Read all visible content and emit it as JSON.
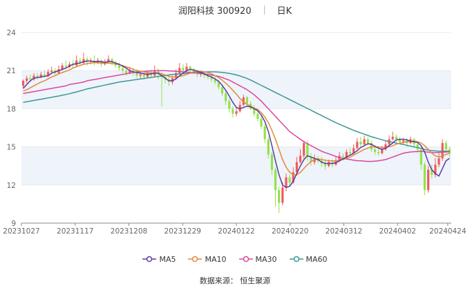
{
  "header": {
    "title": "润阳科技 300920",
    "period": "日K"
  },
  "source_text": "数据来源： 恒生聚源",
  "colors": {
    "up": "#f15a5a",
    "down": "#8fe34b",
    "MA5": "#5b3a9e",
    "MA10": "#e2883c",
    "MA30": "#d9479b",
    "MA60": "#3a9696",
    "band": "#eff3fa",
    "axis": "#666666"
  },
  "chart_data": {
    "type": "candlestick",
    "title": "润阳科技 300920",
    "ylim": [
      9,
      24
    ],
    "yticks": [
      9,
      12,
      15,
      18,
      21,
      24
    ],
    "xticks": [
      "20231027",
      "20231117",
      "20231208",
      "20231229",
      "20240122",
      "20240220",
      "20240312",
      "20240402",
      "20240424"
    ],
    "xtick_index": [
      0,
      15,
      30,
      45,
      60,
      75,
      90,
      105,
      119
    ],
    "legend": [
      "MA5",
      "MA10",
      "MA30",
      "MA60"
    ],
    "legend_position": "bottom",
    "candles": [
      [
        19.8,
        20.2,
        20.3,
        19.6
      ],
      [
        20.2,
        20.4,
        20.6,
        20.0
      ],
      [
        20.4,
        20.3,
        20.7,
        20.1
      ],
      [
        20.3,
        20.6,
        20.8,
        20.2
      ],
      [
        20.6,
        20.5,
        20.8,
        20.3
      ],
      [
        20.5,
        20.7,
        20.9,
        20.4
      ],
      [
        20.7,
        20.6,
        21.0,
        20.5
      ],
      [
        20.6,
        20.9,
        21.1,
        20.5
      ],
      [
        20.9,
        21.0,
        21.3,
        20.8
      ],
      [
        21.0,
        20.8,
        21.2,
        20.6
      ],
      [
        20.8,
        21.1,
        21.4,
        20.7
      ],
      [
        21.1,
        21.4,
        21.6,
        21.0
      ],
      [
        21.4,
        21.3,
        21.8,
        21.1
      ],
      [
        21.3,
        21.5,
        21.7,
        21.2
      ],
      [
        21.5,
        21.4,
        21.8,
        21.2
      ],
      [
        21.4,
        21.8,
        22.2,
        21.3
      ],
      [
        21.8,
        21.6,
        22.0,
        21.4
      ],
      [
        21.6,
        21.9,
        22.4,
        21.5
      ],
      [
        21.9,
        21.7,
        22.1,
        21.4
      ],
      [
        21.7,
        21.8,
        22.0,
        21.5
      ],
      [
        21.8,
        21.6,
        22.2,
        21.4
      ],
      [
        21.6,
        21.8,
        22.0,
        21.5
      ],
      [
        21.8,
        21.5,
        21.9,
        21.3
      ],
      [
        21.5,
        21.7,
        21.9,
        21.4
      ],
      [
        21.7,
        21.9,
        22.2,
        21.6
      ],
      [
        21.9,
        21.6,
        22.0,
        21.4
      ],
      [
        21.6,
        21.4,
        21.8,
        21.2
      ],
      [
        21.4,
        21.2,
        21.6,
        21.0
      ],
      [
        21.2,
        21.0,
        21.4,
        20.8
      ],
      [
        21.0,
        20.8,
        21.2,
        20.6
      ],
      [
        20.8,
        21.0,
        21.3,
        20.7
      ],
      [
        21.0,
        20.9,
        21.2,
        20.6
      ],
      [
        20.9,
        20.6,
        21.1,
        20.4
      ],
      [
        20.6,
        20.7,
        21.0,
        20.4
      ],
      [
        20.7,
        20.5,
        20.9,
        20.3
      ],
      [
        20.5,
        20.8,
        21.0,
        20.4
      ],
      [
        20.8,
        20.6,
        21.1,
        20.4
      ],
      [
        20.6,
        21.0,
        21.4,
        20.5
      ],
      [
        21.0,
        20.7,
        21.2,
        20.3
      ],
      [
        20.7,
        20.5,
        20.9,
        18.2
      ],
      [
        20.5,
        20.3,
        20.7,
        20.0
      ],
      [
        20.3,
        20.1,
        20.5,
        19.8
      ],
      [
        20.1,
        20.4,
        20.6,
        19.9
      ],
      [
        20.4,
        20.8,
        21.1,
        20.3
      ],
      [
        20.8,
        21.2,
        21.6,
        20.7
      ],
      [
        21.2,
        21.0,
        21.5,
        20.8
      ],
      [
        21.0,
        21.3,
        21.6,
        20.9
      ],
      [
        21.3,
        21.1,
        21.4,
        20.8
      ],
      [
        21.1,
        20.9,
        21.2,
        20.7
      ],
      [
        20.9,
        20.7,
        21.1,
        20.5
      ],
      [
        20.7,
        20.8,
        21.0,
        20.5
      ],
      [
        20.8,
        20.6,
        20.9,
        20.4
      ],
      [
        20.6,
        20.5,
        20.8,
        20.3
      ],
      [
        20.5,
        20.3,
        20.7,
        20.1
      ],
      [
        20.3,
        20.1,
        20.5,
        19.9
      ],
      [
        20.1,
        19.7,
        20.3,
        19.5
      ],
      [
        19.7,
        19.2,
        19.9,
        19.0
      ],
      [
        19.2,
        18.6,
        19.4,
        18.3
      ],
      [
        18.6,
        18.0,
        18.8,
        17.7
      ],
      [
        18.0,
        17.6,
        18.2,
        17.3
      ],
      [
        17.6,
        17.8,
        18.1,
        17.4
      ],
      [
        17.8,
        18.3,
        18.6,
        17.7
      ],
      [
        18.3,
        18.9,
        19.1,
        18.2
      ],
      [
        18.9,
        18.4,
        19.0,
        18.2
      ],
      [
        18.4,
        18.0,
        18.6,
        17.9
      ],
      [
        18.0,
        17.6,
        18.3,
        17.4
      ],
      [
        17.6,
        17.2,
        17.8,
        17.0
      ],
      [
        17.2,
        16.6,
        17.4,
        16.4
      ],
      [
        16.6,
        15.6,
        16.8,
        15.3
      ],
      [
        15.6,
        14.4,
        15.8,
        14.1
      ],
      [
        14.4,
        13.2,
        14.6,
        12.8
      ],
      [
        13.2,
        11.6,
        13.4,
        10.3
      ],
      [
        11.6,
        10.6,
        11.9,
        9.8
      ],
      [
        10.6,
        11.8,
        12.2,
        10.4
      ],
      [
        11.8,
        12.6,
        12.9,
        11.5
      ],
      [
        12.6,
        12.2,
        12.8,
        11.9
      ],
      [
        12.2,
        13.0,
        13.4,
        12.1
      ],
      [
        13.0,
        13.8,
        14.2,
        12.9
      ],
      [
        13.8,
        14.3,
        14.8,
        13.7
      ],
      [
        14.3,
        15.3,
        15.5,
        14.1
      ],
      [
        15.3,
        14.2,
        15.5,
        13.9
      ],
      [
        14.2,
        13.8,
        14.5,
        13.5
      ],
      [
        13.8,
        14.1,
        14.4,
        13.6
      ],
      [
        14.1,
        13.9,
        14.3,
        13.7
      ],
      [
        13.9,
        13.7,
        14.2,
        13.4
      ],
      [
        13.7,
        13.5,
        14.0,
        13.2
      ],
      [
        13.5,
        13.8,
        14.0,
        13.4
      ],
      [
        13.8,
        13.6,
        14.0,
        13.4
      ],
      [
        13.6,
        13.9,
        14.2,
        13.5
      ],
      [
        13.9,
        14.3,
        14.6,
        13.8
      ],
      [
        14.3,
        14.2,
        14.5,
        14.0
      ],
      [
        14.2,
        14.6,
        14.8,
        14.1
      ],
      [
        14.6,
        14.5,
        14.9,
        14.3
      ],
      [
        14.5,
        14.9,
        15.2,
        14.4
      ],
      [
        14.9,
        15.4,
        15.7,
        14.8
      ],
      [
        15.4,
        15.2,
        15.8,
        15.0
      ],
      [
        15.2,
        15.6,
        15.9,
        15.1
      ],
      [
        15.6,
        15.3,
        15.8,
        15.1
      ],
      [
        15.3,
        14.8,
        15.5,
        14.6
      ],
      [
        14.8,
        14.6,
        15.0,
        14.4
      ],
      [
        14.6,
        14.5,
        14.9,
        14.3
      ],
      [
        14.5,
        14.8,
        15.1,
        14.4
      ],
      [
        14.8,
        15.2,
        15.5,
        14.7
      ],
      [
        15.2,
        15.6,
        15.9,
        15.1
      ],
      [
        15.6,
        15.8,
        16.2,
        15.5
      ],
      [
        15.8,
        15.6,
        16.0,
        15.4
      ],
      [
        15.6,
        15.4,
        15.8,
        15.2
      ],
      [
        15.4,
        15.5,
        15.7,
        15.2
      ],
      [
        15.5,
        15.3,
        15.7,
        15.0
      ],
      [
        15.3,
        15.6,
        15.8,
        15.2
      ],
      [
        15.6,
        15.2,
        15.7,
        15.0
      ],
      [
        15.2,
        14.8,
        15.4,
        14.5
      ],
      [
        14.8,
        13.6,
        15.0,
        13.2
      ],
      [
        13.6,
        11.6,
        13.8,
        11.2
      ],
      [
        11.6,
        13.2,
        13.5,
        11.4
      ],
      [
        13.2,
        12.8,
        13.6,
        12.5
      ],
      [
        12.8,
        13.6,
        14.1,
        12.6
      ],
      [
        13.6,
        14.1,
        14.5,
        13.4
      ],
      [
        14.1,
        15.3,
        15.6,
        13.9
      ],
      [
        15.3,
        14.8,
        15.5,
        14.5
      ],
      [
        14.8,
        14.5,
        15.0,
        14.2
      ]
    ],
    "MA5": [
      19.6,
      19.9,
      20.2,
      20.4,
      20.45,
      20.5,
      20.55,
      20.6,
      20.8,
      20.9,
      21.0,
      21.1,
      21.2,
      21.35,
      21.5,
      21.55,
      21.6,
      21.7,
      21.75,
      21.75,
      21.7,
      21.72,
      21.7,
      21.65,
      21.7,
      21.7,
      21.6,
      21.5,
      21.35,
      21.2,
      21.0,
      20.9,
      20.85,
      20.8,
      20.75,
      20.7,
      20.75,
      20.8,
      20.8,
      20.6,
      20.4,
      20.2,
      20.2,
      20.35,
      20.6,
      20.8,
      21.0,
      21.1,
      21.05,
      20.95,
      20.85,
      20.75,
      20.6,
      20.5,
      20.35,
      20.15,
      19.85,
      19.45,
      19.0,
      18.5,
      18.1,
      18.0,
      18.1,
      18.2,
      18.15,
      18.0,
      17.85,
      17.5,
      17.0,
      16.2,
      15.1,
      13.9,
      12.8,
      12.0,
      11.8,
      11.9,
      12.3,
      12.9,
      13.5,
      14.0,
      14.3,
      14.2,
      14.1,
      14.0,
      13.8,
      13.7,
      13.7,
      13.7,
      13.75,
      13.9,
      14.05,
      14.2,
      14.35,
      14.5,
      14.7,
      14.95,
      15.1,
      15.25,
      15.2,
      15.05,
      14.9,
      14.8,
      14.9,
      15.1,
      15.3,
      15.55,
      15.6,
      15.6,
      15.55,
      15.45,
      15.4,
      15.35,
      15.1,
      14.6,
      13.8,
      13.2,
      12.9,
      12.7,
      13.3,
      13.9,
      14.1
    ],
    "MA10": [
      19.4,
      19.5,
      19.65,
      19.8,
      19.95,
      20.1,
      20.2,
      20.35,
      20.5,
      20.6,
      20.75,
      20.85,
      20.95,
      21.05,
      21.2,
      21.3,
      21.4,
      21.5,
      21.55,
      21.6,
      21.62,
      21.62,
      21.6,
      21.6,
      21.58,
      21.56,
      21.52,
      21.46,
      21.4,
      21.3,
      21.2,
      21.1,
      21.0,
      20.95,
      20.9,
      20.85,
      20.82,
      20.8,
      20.8,
      20.75,
      20.65,
      20.55,
      20.5,
      20.5,
      20.55,
      20.6,
      20.7,
      20.8,
      20.9,
      20.95,
      20.95,
      20.9,
      20.85,
      20.75,
      20.6,
      20.45,
      20.25,
      20.0,
      19.75,
      19.45,
      19.15,
      18.8,
      18.55,
      18.35,
      18.2,
      18.05,
      17.95,
      17.7,
      17.35,
      16.9,
      16.3,
      15.6,
      14.8,
      14.0,
      13.4,
      13.0,
      12.8,
      12.8,
      13.0,
      13.3,
      13.6,
      13.85,
      14.0,
      14.05,
      14.0,
      13.95,
      13.9,
      13.9,
      13.9,
      13.95,
      14.0,
      14.1,
      14.2,
      14.35,
      14.5,
      14.65,
      14.8,
      14.9,
      15.0,
      15.0,
      15.0,
      14.95,
      14.95,
      15.0,
      15.1,
      15.2,
      15.3,
      15.35,
      15.4,
      15.45,
      15.45,
      15.4,
      15.3,
      15.1,
      14.8,
      14.5,
      14.3,
      14.2,
      14.3,
      14.4,
      14.5
    ],
    "MA30": [
      19.2,
      19.25,
      19.3,
      19.35,
      19.4,
      19.45,
      19.5,
      19.55,
      19.6,
      19.65,
      19.7,
      19.75,
      19.8,
      19.9,
      19.95,
      20.0,
      20.05,
      20.1,
      20.2,
      20.25,
      20.3,
      20.35,
      20.4,
      20.45,
      20.5,
      20.55,
      20.6,
      20.65,
      20.7,
      20.75,
      20.8,
      20.85,
      20.9,
      20.92,
      20.94,
      20.96,
      20.98,
      21.0,
      21.0,
      21.0,
      21.0,
      20.98,
      20.96,
      20.94,
      20.92,
      20.9,
      20.88,
      20.86,
      20.84,
      20.8,
      20.78,
      20.74,
      20.7,
      20.65,
      20.6,
      20.55,
      20.45,
      20.35,
      20.25,
      20.1,
      19.95,
      19.8,
      19.65,
      19.5,
      19.3,
      19.1,
      18.85,
      18.6,
      18.3,
      18.0,
      17.7,
      17.4,
      17.1,
      16.8,
      16.5,
      16.2,
      16.0,
      15.8,
      15.6,
      15.4,
      15.25,
      15.1,
      14.95,
      14.8,
      14.65,
      14.55,
      14.45,
      14.35,
      14.25,
      14.15,
      14.1,
      14.05,
      14.0,
      13.95,
      13.9,
      13.9,
      13.88,
      13.86,
      13.86,
      13.88,
      13.9,
      13.95,
      14.0,
      14.1,
      14.2,
      14.3,
      14.4,
      14.5,
      14.55,
      14.6,
      14.62,
      14.64,
      14.65,
      14.62,
      14.58,
      14.55,
      14.55,
      14.56,
      14.58,
      14.6,
      14.62
    ],
    "MA60": [
      18.5,
      18.55,
      18.6,
      18.65,
      18.7,
      18.75,
      18.8,
      18.85,
      18.9,
      18.95,
      19.0,
      19.06,
      19.12,
      19.18,
      19.25,
      19.32,
      19.4,
      19.48,
      19.56,
      19.62,
      19.68,
      19.74,
      19.8,
      19.86,
      19.92,
      19.98,
      20.04,
      20.1,
      20.14,
      20.18,
      20.22,
      20.26,
      20.3,
      20.34,
      20.38,
      20.42,
      20.46,
      20.5,
      20.54,
      20.58,
      20.62,
      20.66,
      20.7,
      20.72,
      20.74,
      20.76,
      20.78,
      20.8,
      20.82,
      20.84,
      20.86,
      20.88,
      20.9,
      20.9,
      20.9,
      20.88,
      20.86,
      20.82,
      20.78,
      20.72,
      20.66,
      20.58,
      20.48,
      20.38,
      20.26,
      20.12,
      19.98,
      19.84,
      19.7,
      19.56,
      19.42,
      19.28,
      19.14,
      19.0,
      18.86,
      18.72,
      18.58,
      18.44,
      18.3,
      18.16,
      18.02,
      17.88,
      17.74,
      17.6,
      17.46,
      17.32,
      17.18,
      17.04,
      16.9,
      16.78,
      16.66,
      16.54,
      16.42,
      16.3,
      16.2,
      16.1,
      16.0,
      15.9,
      15.8,
      15.72,
      15.64,
      15.56,
      15.48,
      15.42,
      15.36,
      15.3,
      15.24,
      15.18,
      15.12,
      15.06,
      15.0,
      14.94,
      14.88,
      14.8,
      14.75,
      14.7,
      14.68,
      14.66,
      14.66,
      14.66,
      14.66
    ]
  }
}
